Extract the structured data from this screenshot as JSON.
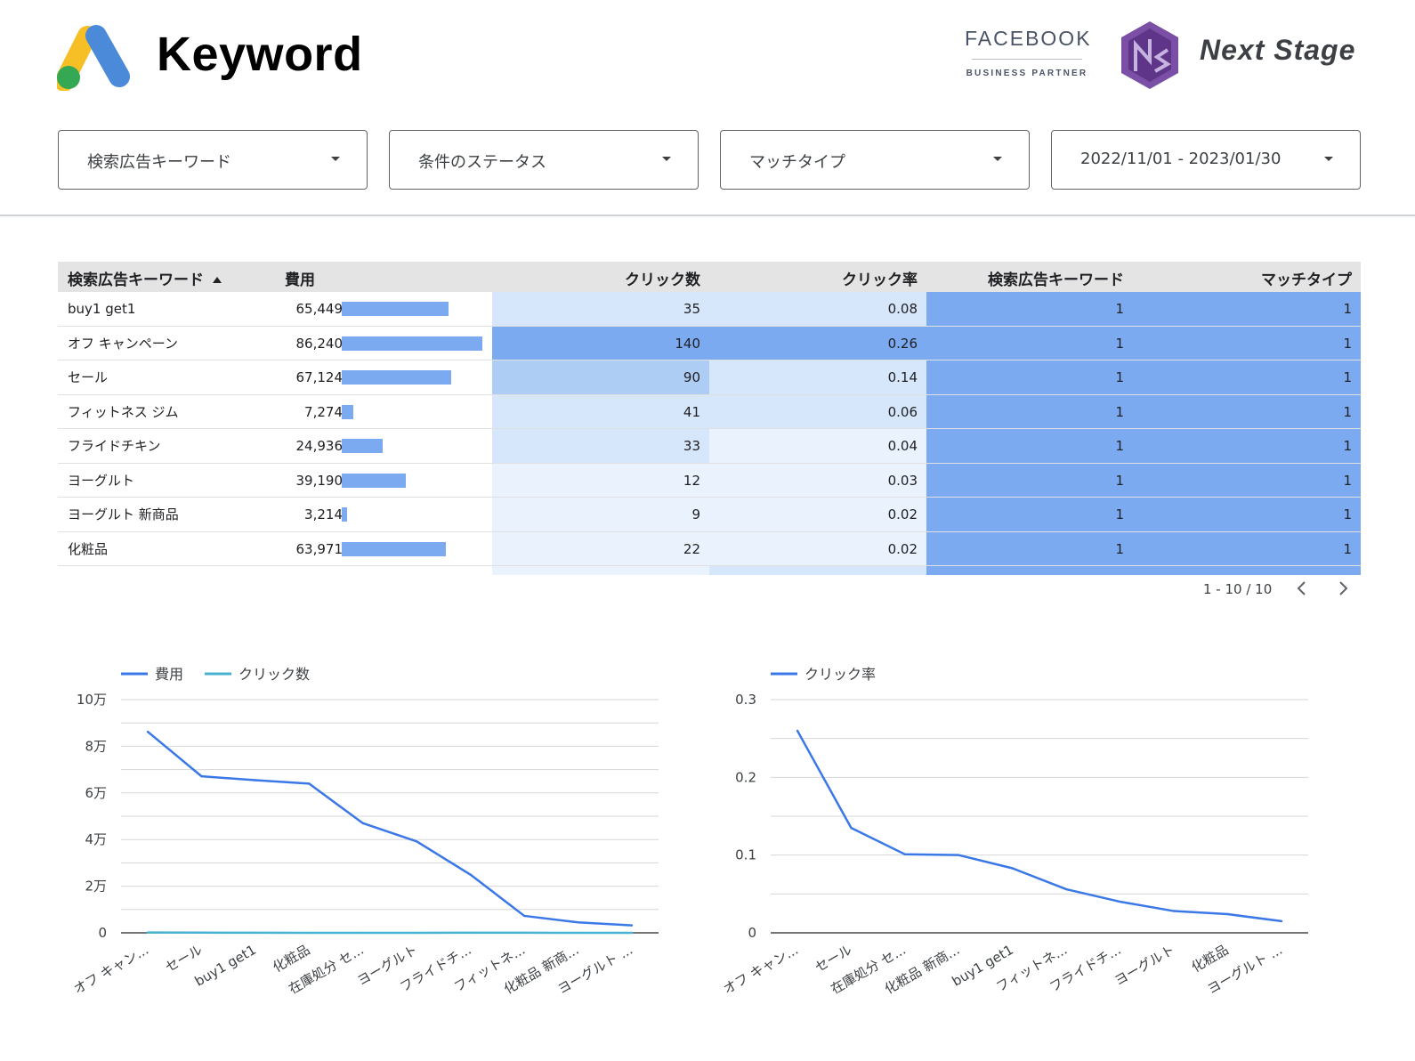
{
  "header": {
    "title": "Keyword",
    "partner": {
      "brand": "FACEBOOK",
      "subtitle": "BUSINESS PARTNER"
    },
    "company": "Next Stage",
    "icons": [
      "google-ads-logo-icon",
      "next-stage-logo-icon"
    ]
  },
  "filters": [
    {
      "label": "検索広告キーワード"
    },
    {
      "label": "条件のステータス"
    },
    {
      "label": "マッチタイプ"
    },
    {
      "label": "2022/11/01 - 2023/01/30"
    }
  ],
  "table": {
    "headers": [
      "検索広告キーワード",
      "費用",
      "クリック数",
      "クリック率",
      "検索広告キーワード",
      "マッチタイプ"
    ],
    "rows": [
      {
        "keyword": "buy1 get1",
        "cost": "65,449",
        "cost_value": 65449,
        "clicks": "35",
        "ctr": "0.08",
        "kw_count": "1",
        "match_type": "1"
      },
      {
        "keyword": "オフ キャンペーン",
        "cost": "86,240",
        "cost_value": 86240,
        "clicks": "140",
        "ctr": "0.26",
        "kw_count": "1",
        "match_type": "1"
      },
      {
        "keyword": "セール",
        "cost": "67,124",
        "cost_value": 67124,
        "clicks": "90",
        "ctr": "0.14",
        "kw_count": "1",
        "match_type": "1"
      },
      {
        "keyword": "フィットネス ジム",
        "cost": "7,274",
        "cost_value": 7274,
        "clicks": "41",
        "ctr": "0.06",
        "kw_count": "1",
        "match_type": "1"
      },
      {
        "keyword": "フライドチキン",
        "cost": "24,936",
        "cost_value": 24936,
        "clicks": "33",
        "ctr": "0.04",
        "kw_count": "1",
        "match_type": "1"
      },
      {
        "keyword": "ヨーグルト",
        "cost": "39,190",
        "cost_value": 39190,
        "clicks": "12",
        "ctr": "0.03",
        "kw_count": "1",
        "match_type": "1"
      },
      {
        "keyword": "ヨーグルト 新商品",
        "cost": "3,214",
        "cost_value": 3214,
        "clicks": "9",
        "ctr": "0.02",
        "kw_count": "1",
        "match_type": "1"
      },
      {
        "keyword": "化粧品",
        "cost": "63,971",
        "cost_value": 63971,
        "clicks": "22",
        "ctr": "0.02",
        "kw_count": "1",
        "match_type": "1"
      }
    ],
    "pagination": "1 - 10 / 10"
  },
  "colors": {
    "accent": "#7baaf0",
    "heat_strong": "#7baaf0",
    "heat_mid": "#aecdf5",
    "heat_light": "#d6e6fb",
    "heat_faint": "#eaf2fd",
    "line_cost": "#3b78e7",
    "line_clicks": "#48b2cf"
  },
  "chart_data": [
    {
      "type": "line",
      "categories": [
        "オフ キャン...",
        "セール",
        "buy1 get1",
        "化粧品",
        "在庫処分 セ...",
        "ヨーグルト",
        "フライドチ...",
        "フィットネ...",
        "化粧品 新商...",
        "ヨーグルト ..."
      ],
      "series": [
        {
          "name": "費用",
          "values": [
            86240,
            67124,
            65449,
            63971,
            47000,
            39190,
            24936,
            7274,
            4500,
            3214
          ]
        },
        {
          "name": "クリック数",
          "values": [
            140,
            90,
            35,
            22,
            20,
            12,
            33,
            41,
            10,
            9
          ]
        }
      ],
      "yticks": [
        "0",
        "2万",
        "4万",
        "6万",
        "8万",
        "10万"
      ],
      "ylim": [
        0,
        100000
      ],
      "grid": true,
      "legend": "top-left"
    },
    {
      "type": "line",
      "categories": [
        "オフ キャン...",
        "セール",
        "在庫処分 セ...",
        "化粧品 新商...",
        "buy1 get1",
        "フィットネ...",
        "フライドチ...",
        "ヨーグルト",
        "化粧品",
        "ヨーグルト ..."
      ],
      "series": [
        {
          "name": "クリック率",
          "values": [
            0.26,
            0.135,
            0.101,
            0.1,
            0.083,
            0.056,
            0.04,
            0.028,
            0.024,
            0.015
          ]
        }
      ],
      "yticks": [
        "0",
        "0.1",
        "0.2",
        "0.3"
      ],
      "ylim": [
        0,
        0.3
      ],
      "grid": true,
      "legend": "top-left"
    }
  ]
}
